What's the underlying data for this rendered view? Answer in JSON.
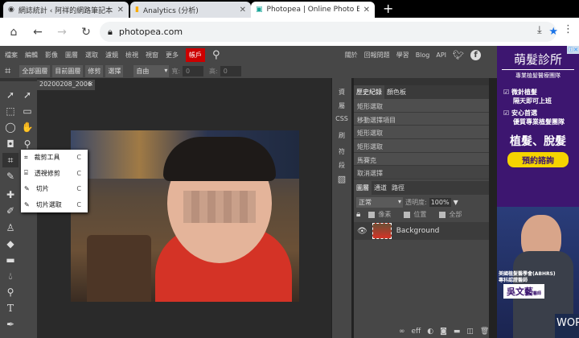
{
  "browser": {
    "tabs": [
      {
        "title": "網誌統計 ‹ 阿祥的網路筆記本 -"
      },
      {
        "title": "Analytics (分析)"
      },
      {
        "title": "Photopea | Online Photo Edi"
      }
    ],
    "url": "photopea.com"
  },
  "menu": {
    "items": [
      "檔案",
      "編輯",
      "影像",
      "圖層",
      "選取",
      "濾鏡",
      "檢視",
      "視窗",
      "更多"
    ],
    "account": "帳戶",
    "right": [
      "關於",
      "回報問題",
      "學習",
      "Blog",
      "API"
    ]
  },
  "options": {
    "buttons": [
      "全部圖層",
      "目前圖層",
      "修剪",
      "選擇"
    ],
    "mode": "自由",
    "width_label": "寬:",
    "width": "0",
    "height_label": "高:",
    "height": "0"
  },
  "document": {
    "tab": "20200208_2006"
  },
  "flyout": [
    {
      "label": "裁剪工具",
      "key": "C"
    },
    {
      "label": "透視修剪",
      "key": "C"
    },
    {
      "label": "切片",
      "key": "C"
    },
    {
      "label": "切片選取",
      "key": "C"
    }
  ],
  "narrow_panel": [
    "資",
    "屬",
    "CSS",
    "刷",
    "符",
    "段"
  ],
  "history": {
    "tabs": [
      "歷史紀錄",
      "顏色板"
    ],
    "items": [
      "矩形選取",
      "移動選擇項目",
      "矩形選取",
      "矩形選取",
      "馬賽克",
      "取消選擇"
    ]
  },
  "layers": {
    "tabs": [
      "圖層",
      "通道",
      "路徑"
    ],
    "blend": "正常",
    "opacity_label": "透明度:",
    "opacity": "100%",
    "lock_options": [
      "像素",
      "位置",
      "全部"
    ],
    "layer_name": "Background",
    "footer_off": "eff"
  },
  "ad": {
    "title": "萌髮診所",
    "subtitle": "專業植髮醫療團隊",
    "point1a": "微針植髮",
    "point1b": "隔天即可上班",
    "point2a": "安心首選",
    "point2b": "優質專業植髮團隊",
    "headline": "植髮、脫髮",
    "cta": "預約諮詢",
    "credential1": "美國植髮醫學會(ABHRS)",
    "credential2": "專科認證醫師",
    "doctor": "吳文藝",
    "doctor_title": "醫師",
    "sign": "WOR"
  }
}
